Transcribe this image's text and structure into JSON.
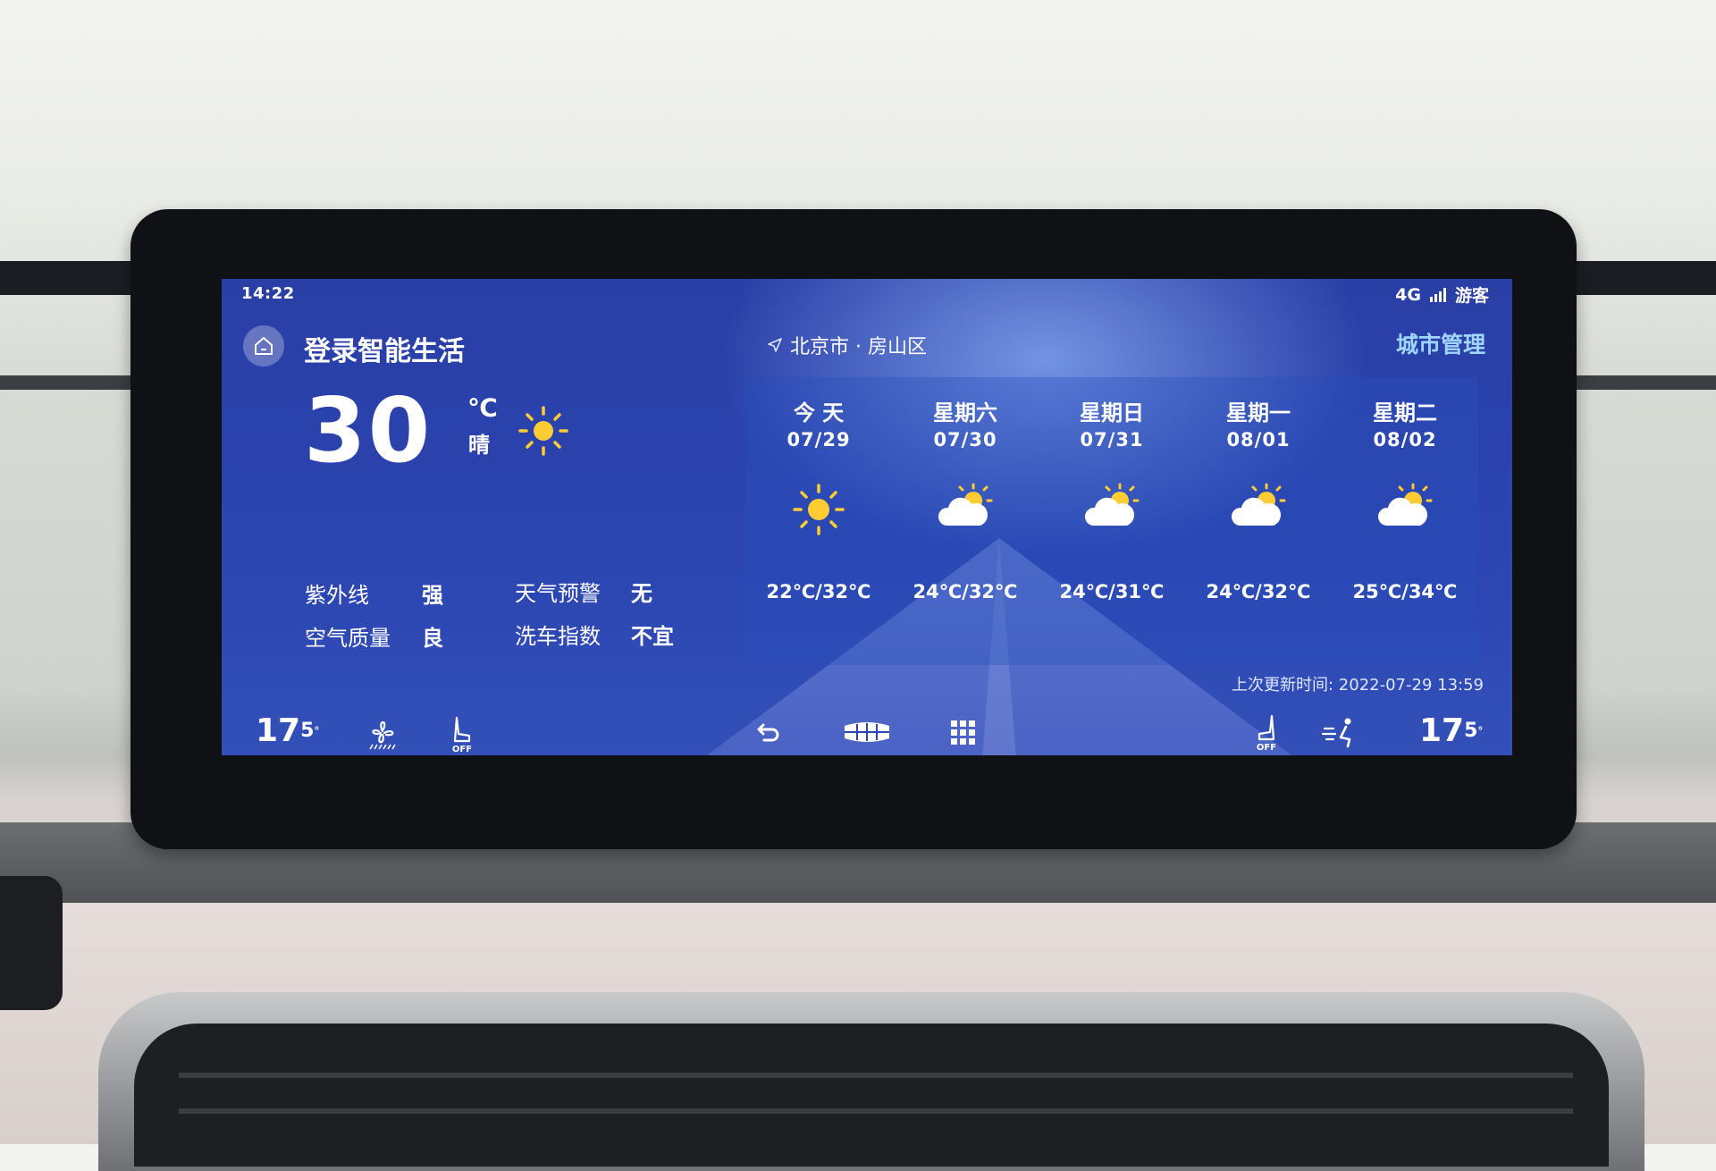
{
  "status_bar": {
    "time": "14:22",
    "network": "4G",
    "user": "游客"
  },
  "header": {
    "login_title": "登录智能生活",
    "location": "北京市 · 房山区",
    "city_management": "城市管理"
  },
  "current": {
    "temperature": "30",
    "unit": "℃",
    "condition": "晴",
    "icon": "sun-icon"
  },
  "indices": [
    {
      "label": "紫外线",
      "value": "强"
    },
    {
      "label": "天气预警",
      "value": "无"
    },
    {
      "label": "空气质量",
      "value": "良"
    },
    {
      "label": "洗车指数",
      "value": "不宜"
    }
  ],
  "forecast": [
    {
      "day": "今 天",
      "date": "07/29",
      "icon": "sun-icon",
      "range": "22℃/32℃"
    },
    {
      "day": "星期六",
      "date": "07/30",
      "icon": "partly-cloudy-icon",
      "range": "24℃/32℃"
    },
    {
      "day": "星期日",
      "date": "07/31",
      "icon": "partly-cloudy-icon",
      "range": "24℃/31℃"
    },
    {
      "day": "星期一",
      "date": "08/01",
      "icon": "partly-cloudy-icon",
      "range": "24℃/32℃"
    },
    {
      "day": "星期二",
      "date": "08/02",
      "icon": "partly-cloudy-icon",
      "range": "25℃/34℃"
    }
  ],
  "last_updated": "上次更新时间: 2022-07-29 13:59",
  "climate_bar": {
    "left_temp_int": "17",
    "left_temp_dec": "5",
    "left_temp_deg": "°",
    "right_temp_int": "17",
    "right_temp_dec": "5",
    "right_temp_deg": "°",
    "left_seat_label": "OFF",
    "right_seat_label": "OFF"
  },
  "colors": {
    "screen_bg": "#2b44b0",
    "accent_link": "#9fd6ff",
    "sun": "#ffcc33"
  }
}
